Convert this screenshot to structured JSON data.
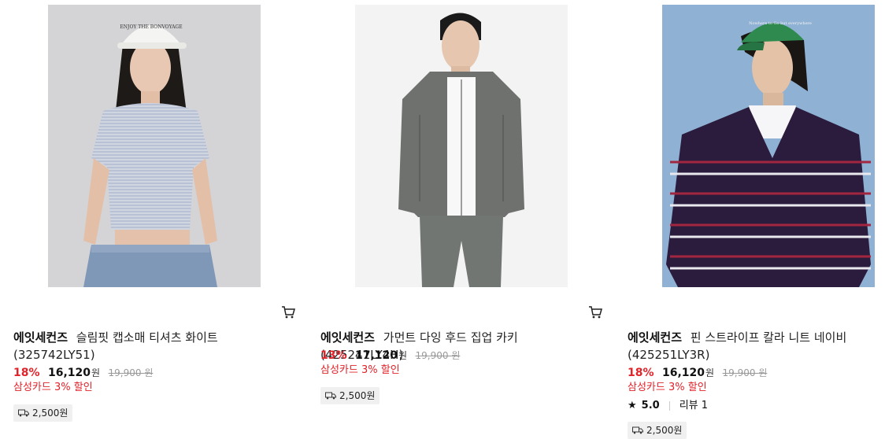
{
  "products": [
    {
      "brand": "에잇세컨즈",
      "name": "슬림핏 캡소매 티셔츠 화이트 (325742LY51)",
      "discount": "18%",
      "price": "16,120",
      "currency": "원",
      "original_price": "19,900",
      "original_currency": "원",
      "card_discount": "삼성카드 3% 할인",
      "shipping": "2,500원",
      "cap_text": "ENJOY THE BONVOYAGE"
    },
    {
      "brand": "에잇세컨즈",
      "name": "가먼트 다잉 후드 집업 카키 (425241LY4H)",
      "discount": "13%",
      "price": "17,120",
      "currency": "원",
      "original_price": "19,900",
      "original_currency": "원",
      "card_discount": "삼성카드 3% 할인",
      "shipping": "2,500원"
    },
    {
      "brand": "에잇세컨즈",
      "name": "핀 스트라이프 칼라 니트 네이비 (425251LY3R)",
      "discount": "18%",
      "price": "16,120",
      "currency": "원",
      "original_price": "19,900",
      "original_currency": "원",
      "card_discount": "삼성카드 3% 할인",
      "rating": "5.0",
      "reviews": "리뷰 1",
      "shipping": "2,500원",
      "cap_text": "Nowhere to Go but everywhere"
    }
  ],
  "icons": {
    "cart": "cart-icon",
    "truck": "truck-icon",
    "star": "star-icon"
  },
  "colors": {
    "discount": "#e1232a",
    "strike": "#999999",
    "ship_bg": "#f0f0f0"
  }
}
